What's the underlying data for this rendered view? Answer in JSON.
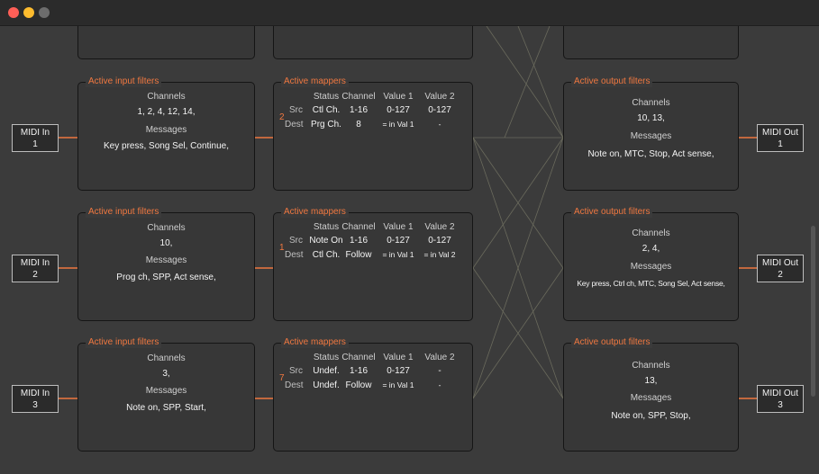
{
  "window": {
    "controls": [
      "close",
      "minimize",
      "zoom"
    ]
  },
  "colors": {
    "accent": "#f07840",
    "background": "#3b3b3b",
    "panel": "#373737"
  },
  "midi_inputs": [
    {
      "line1": "MIDI In",
      "line2": "1"
    },
    {
      "line1": "MIDI In",
      "line2": "2"
    },
    {
      "line1": "MIDI In",
      "line2": "3"
    }
  ],
  "midi_outputs": [
    {
      "line1": "MIDI Out",
      "line2": "1"
    },
    {
      "line1": "MIDI Out",
      "line2": "2"
    },
    {
      "line1": "MIDI Out",
      "line2": "3"
    }
  ],
  "input_filters": [
    {
      "title": "Active input filters",
      "channels_label": "Channels",
      "channels": "1, 2, 4, 12, 14,",
      "messages_label": "Messages",
      "messages": "Key press, Song Sel, Continue,"
    },
    {
      "title": "Active input filters",
      "channels_label": "Channels",
      "channels": "10,",
      "messages_label": "Messages",
      "messages": "Prog ch, SPP, Act sense,"
    },
    {
      "title": "Active input filters",
      "channels_label": "Channels",
      "channels": "3,",
      "messages_label": "Messages",
      "messages": "Note on, SPP, Start,"
    }
  ],
  "mappers": [
    {
      "title": "Active mappers",
      "index": "2",
      "headers": [
        "Status",
        "Channel",
        "Value 1",
        "Value 2"
      ],
      "src_label": "Src",
      "dest_label": "Dest",
      "src": [
        "Ctl Ch.",
        "1-16",
        "0-127",
        "0-127"
      ],
      "dest": [
        "Prg Ch.",
        "8",
        "= in Val 1",
        "-"
      ]
    },
    {
      "title": "Active mappers",
      "index": "1",
      "headers": [
        "Status",
        "Channel",
        "Value 1",
        "Value 2"
      ],
      "src_label": "Src",
      "dest_label": "Dest",
      "src": [
        "Note On",
        "1-16",
        "0-127",
        "0-127"
      ],
      "dest": [
        "Ctl Ch.",
        "Follow",
        "= in Val 1",
        "= in Val 2"
      ]
    },
    {
      "title": "Active mappers",
      "index": "7",
      "headers": [
        "Status",
        "Channel",
        "Value 1",
        "Value 2"
      ],
      "src_label": "Src",
      "dest_label": "Dest",
      "src": [
        "Undef.",
        "1-16",
        "0-127",
        "-"
      ],
      "dest": [
        "Undef.",
        "Follow",
        "= in Val 1",
        "-"
      ]
    }
  ],
  "output_filters": [
    {
      "title": "Active output filters",
      "channels_label": "Channels",
      "channels": "10, 13,",
      "messages_label": "Messages",
      "messages": "Note on, MTC, Stop, Act sense,"
    },
    {
      "title": "Active output filters",
      "channels_label": "Channels",
      "channels": "2, 4,",
      "messages_label": "Messages",
      "messages": "Key press, Ctrl ch, MTC, Song Sel, Act sense,"
    },
    {
      "title": "Active output filters",
      "channels_label": "Channels",
      "channels": "13,",
      "messages_label": "Messages",
      "messages": "Note on, SPP, Stop,"
    }
  ]
}
